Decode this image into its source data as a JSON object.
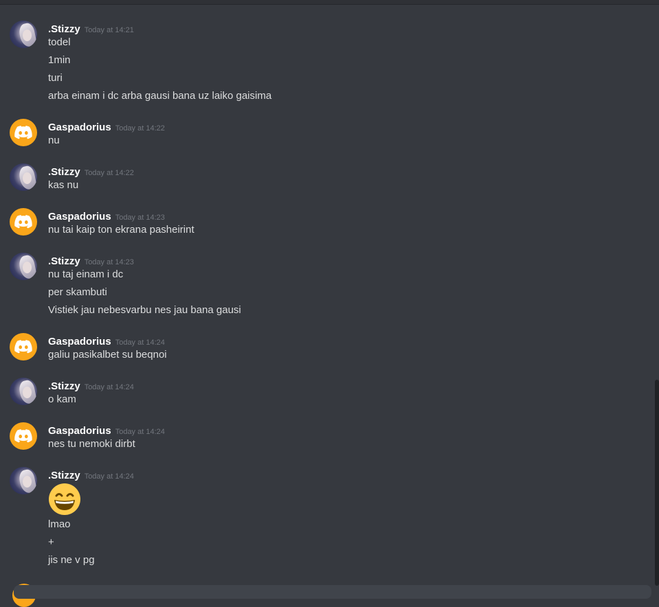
{
  "colors": {
    "background": "#36393f",
    "username": "#ffffff",
    "timestamp": "#72767d",
    "message_text": "#dcddde",
    "discord_avatar": "#faa61a"
  },
  "messages": [
    {
      "author": ".Stizzy",
      "avatar": "photo-avatar",
      "time": "Today at 14:21",
      "lines": [
        "todel",
        "1min",
        "turi",
        "arba einam i dc arba gausi bana uz laiko gaisima"
      ]
    },
    {
      "author": "Gaspadorius",
      "avatar": "discord-logo-icon",
      "time": "Today at 14:22",
      "lines": [
        "nu"
      ]
    },
    {
      "author": ".Stizzy",
      "avatar": "photo-avatar",
      "time": "Today at 14:22",
      "lines": [
        "kas nu"
      ]
    },
    {
      "author": "Gaspadorius",
      "avatar": "discord-logo-icon",
      "time": "Today at 14:23",
      "lines": [
        "nu tai kaip ton ekrana pasheirint"
      ]
    },
    {
      "author": ".Stizzy",
      "avatar": "photo-avatar",
      "time": "Today at 14:23",
      "lines": [
        "nu taj einam i dc",
        "per skambuti",
        "Vistiek jau nebesvarbu nes jau bana gausi"
      ]
    },
    {
      "author": "Gaspadorius",
      "avatar": "discord-logo-icon",
      "time": "Today at 14:24",
      "lines": [
        "galiu pasikalbet su beqnoi"
      ]
    },
    {
      "author": ".Stizzy",
      "avatar": "photo-avatar",
      "time": "Today at 14:24",
      "lines": [
        "o kam"
      ]
    },
    {
      "author": "Gaspadorius",
      "avatar": "discord-logo-icon",
      "time": "Today at 14:24",
      "lines": [
        "nes tu nemoki dirbt"
      ]
    },
    {
      "author": ".Stizzy",
      "avatar": "photo-avatar",
      "time": "Today at 14:24",
      "emoji": "grinning-smile-emoji",
      "lines": [
        "lmao",
        "+",
        "jis ne v pg"
      ]
    }
  ]
}
